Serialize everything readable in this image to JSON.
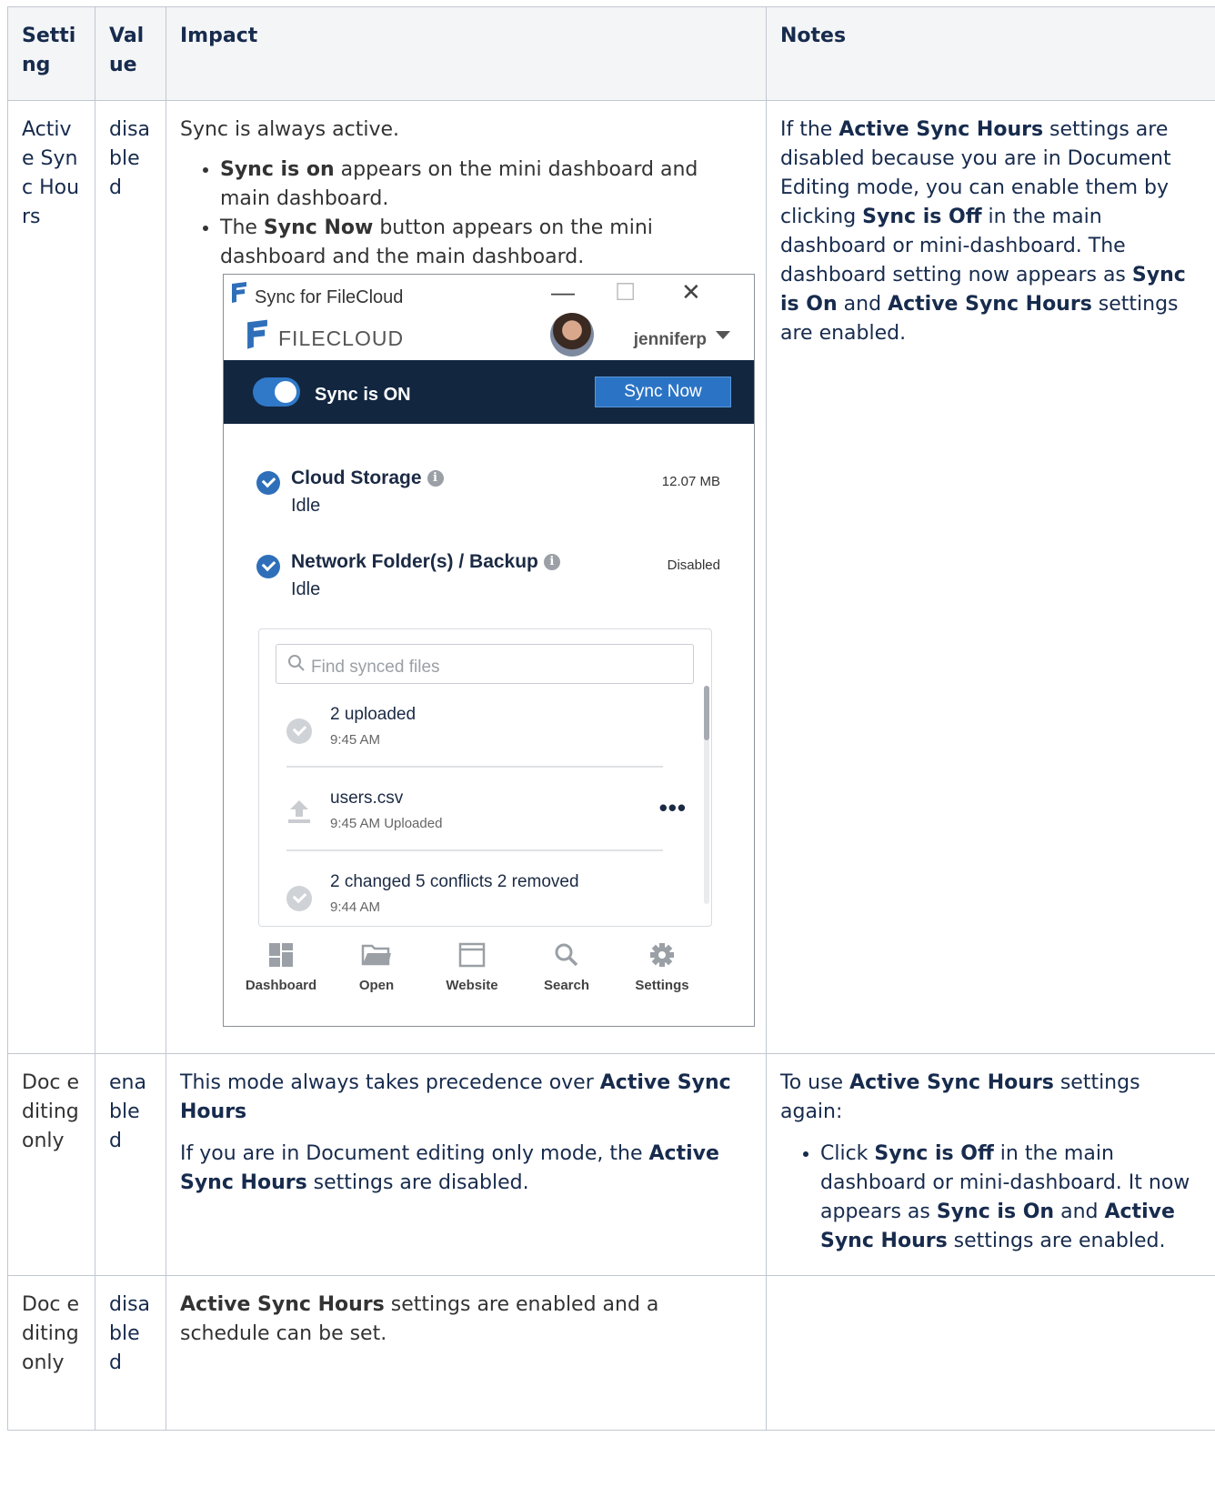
{
  "table": {
    "headers": [
      "Setting",
      "Value",
      "Impact",
      "Notes"
    ],
    "rows": [
      {
        "setting": "Active Sync Hours",
        "value": "disabled",
        "impact": {
          "intro": "Sync is always active.",
          "bullets": [
            {
              "bold": "Sync is on",
              "rest": " appears on the mini dashboard and main dashboard."
            },
            {
              "pre": "The ",
              "bold": "Sync Now",
              "rest": " button appears on the mini dashboard and the main dashboard."
            }
          ]
        },
        "notes": {
          "s1": "If the ",
          "b1": "Active Sync Hours",
          "s2": " settings are disabled because you are in Document Editing mode, you can enable them by clicking ",
          "b2": "Sync is Off",
          "s3": " in the main dashboard or mini-dashboard. The dashboard setting now appears as ",
          "b3": "Sync is On",
          "s4": " and ",
          "b4": "Active Sync Hours",
          "s5": " settings are enabled."
        }
      },
      {
        "setting": "Doc editing only",
        "value": "enabled",
        "impact": {
          "p1_text": "This mode always takes precedence over ",
          "p1_bold": "Active Sync Hours",
          "p2_text": "If you are in Document editing only mode, the ",
          "p2_bold": "Active Sync Hours",
          "p2_rest": " settings are disabled."
        },
        "notes": {
          "intro_pre": "To use ",
          "intro_bold": "Active Sync Hours",
          "intro_rest": " settings again:",
          "li_s1": "Click ",
          "li_b1": "Sync is Off",
          "li_s2": " in the main dashboard or mini-dashboard. It now appears as ",
          "li_b2": "Sync is On",
          "li_s3": " and ",
          "li_b3": "Active Sync Hours",
          "li_s4": " settings are enabled."
        }
      },
      {
        "setting": "Doc editing only",
        "value": "disabled",
        "impact": {
          "bold": "Active Sync Hours",
          "rest": " settings are enabled and a schedule can be set."
        },
        "notes": ""
      }
    ]
  },
  "sync_window": {
    "title": "Sync for FileCloud",
    "window_controls": {
      "minimize": "—",
      "maximize": "☐",
      "close": "✕"
    },
    "brand": "FILECLOUD",
    "username": "jenniferp",
    "toggle_label": "Sync is ON",
    "toggle_on": true,
    "sync_now": "Sync Now",
    "storage": [
      {
        "name": "Cloud Storage",
        "status": "Idle",
        "right": "12.07 MB"
      },
      {
        "name": "Network Folder(s) / Backup",
        "status": "Idle",
        "right": "Disabled"
      }
    ],
    "search_placeholder": "Find synced files",
    "activity": [
      {
        "title": "2 uploaded",
        "sub": "9:45 AM",
        "icon": "check-circle-icon"
      },
      {
        "title": "users.csv",
        "sub": "9:45 AM Uploaded",
        "icon": "upload-icon",
        "more": "•••"
      },
      {
        "title": "2 changed 5 conflicts 2 removed",
        "sub": "9:44 AM",
        "icon": "check-circle-icon"
      }
    ],
    "nav": [
      {
        "label": "Dashboard",
        "icon": "dashboard-icon"
      },
      {
        "label": "Open",
        "icon": "folder-icon"
      },
      {
        "label": "Website",
        "icon": "browser-window-icon"
      },
      {
        "label": "Search",
        "icon": "search-icon"
      },
      {
        "label": "Settings",
        "icon": "gear-icon"
      }
    ],
    "colors": {
      "bar": "#122640",
      "accent": "#2b74c5",
      "check": "#2f6fba"
    }
  }
}
